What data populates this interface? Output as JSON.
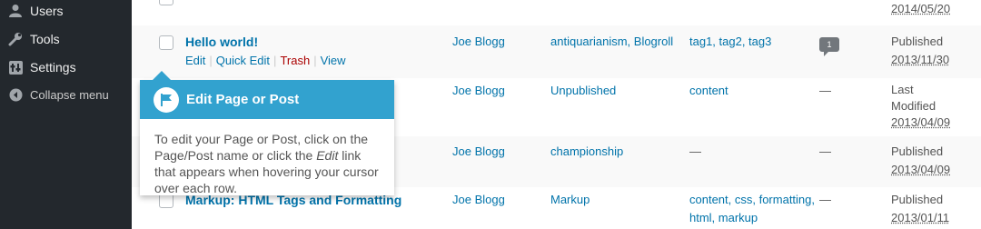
{
  "sidebar": {
    "items": [
      {
        "label": "Users",
        "icon": "users-icon"
      },
      {
        "label": "Tools",
        "icon": "tools-icon"
      },
      {
        "label": "Settings",
        "icon": "settings-icon"
      },
      {
        "label": "Collapse menu",
        "icon": "collapse-icon"
      }
    ]
  },
  "rows": [
    {
      "date_status": "",
      "date": "2014/05/20"
    },
    {
      "title": "Hello world!",
      "author": "Joe Blogg",
      "categories": "antiquarianism, Blogroll",
      "tags": "tag1, tag2, tag3",
      "comments": "1",
      "date_status": "Published",
      "date": "2013/11/30",
      "actions": {
        "edit": "Edit",
        "quick_edit": "Quick Edit",
        "trash": "Trash",
        "view": "View"
      }
    },
    {
      "author": "Joe Blogg",
      "categories": "Unpublished",
      "tags": "content",
      "comments": "—",
      "date_status_1": "Last",
      "date_status_2": "Modified",
      "date": "2013/04/09"
    },
    {
      "author": "Joe Blogg",
      "categories": "championship",
      "tags": "—",
      "comments": "—",
      "date_status": "Published",
      "date": "2013/04/09"
    },
    {
      "title": "Markup: HTML Tags and Formatting",
      "author": "Joe Blogg",
      "categories": "Markup",
      "tags_1": "content, css, formatting,",
      "tags_2": "html, markup",
      "comments": "—",
      "date_status": "Published",
      "date": "2013/01/11"
    }
  ],
  "pointer": {
    "title": "Edit Page or Post",
    "body_1": "To edit your Page or Post, click on the Page/Post name or click the ",
    "body_em": "Edit",
    "body_2": " link that appears when hovering your cursor over each row."
  },
  "colors": {
    "sidebar": "#23282d",
    "link": "#0073aa",
    "pointer_head": "#32a2cf",
    "trash": "#a00"
  }
}
